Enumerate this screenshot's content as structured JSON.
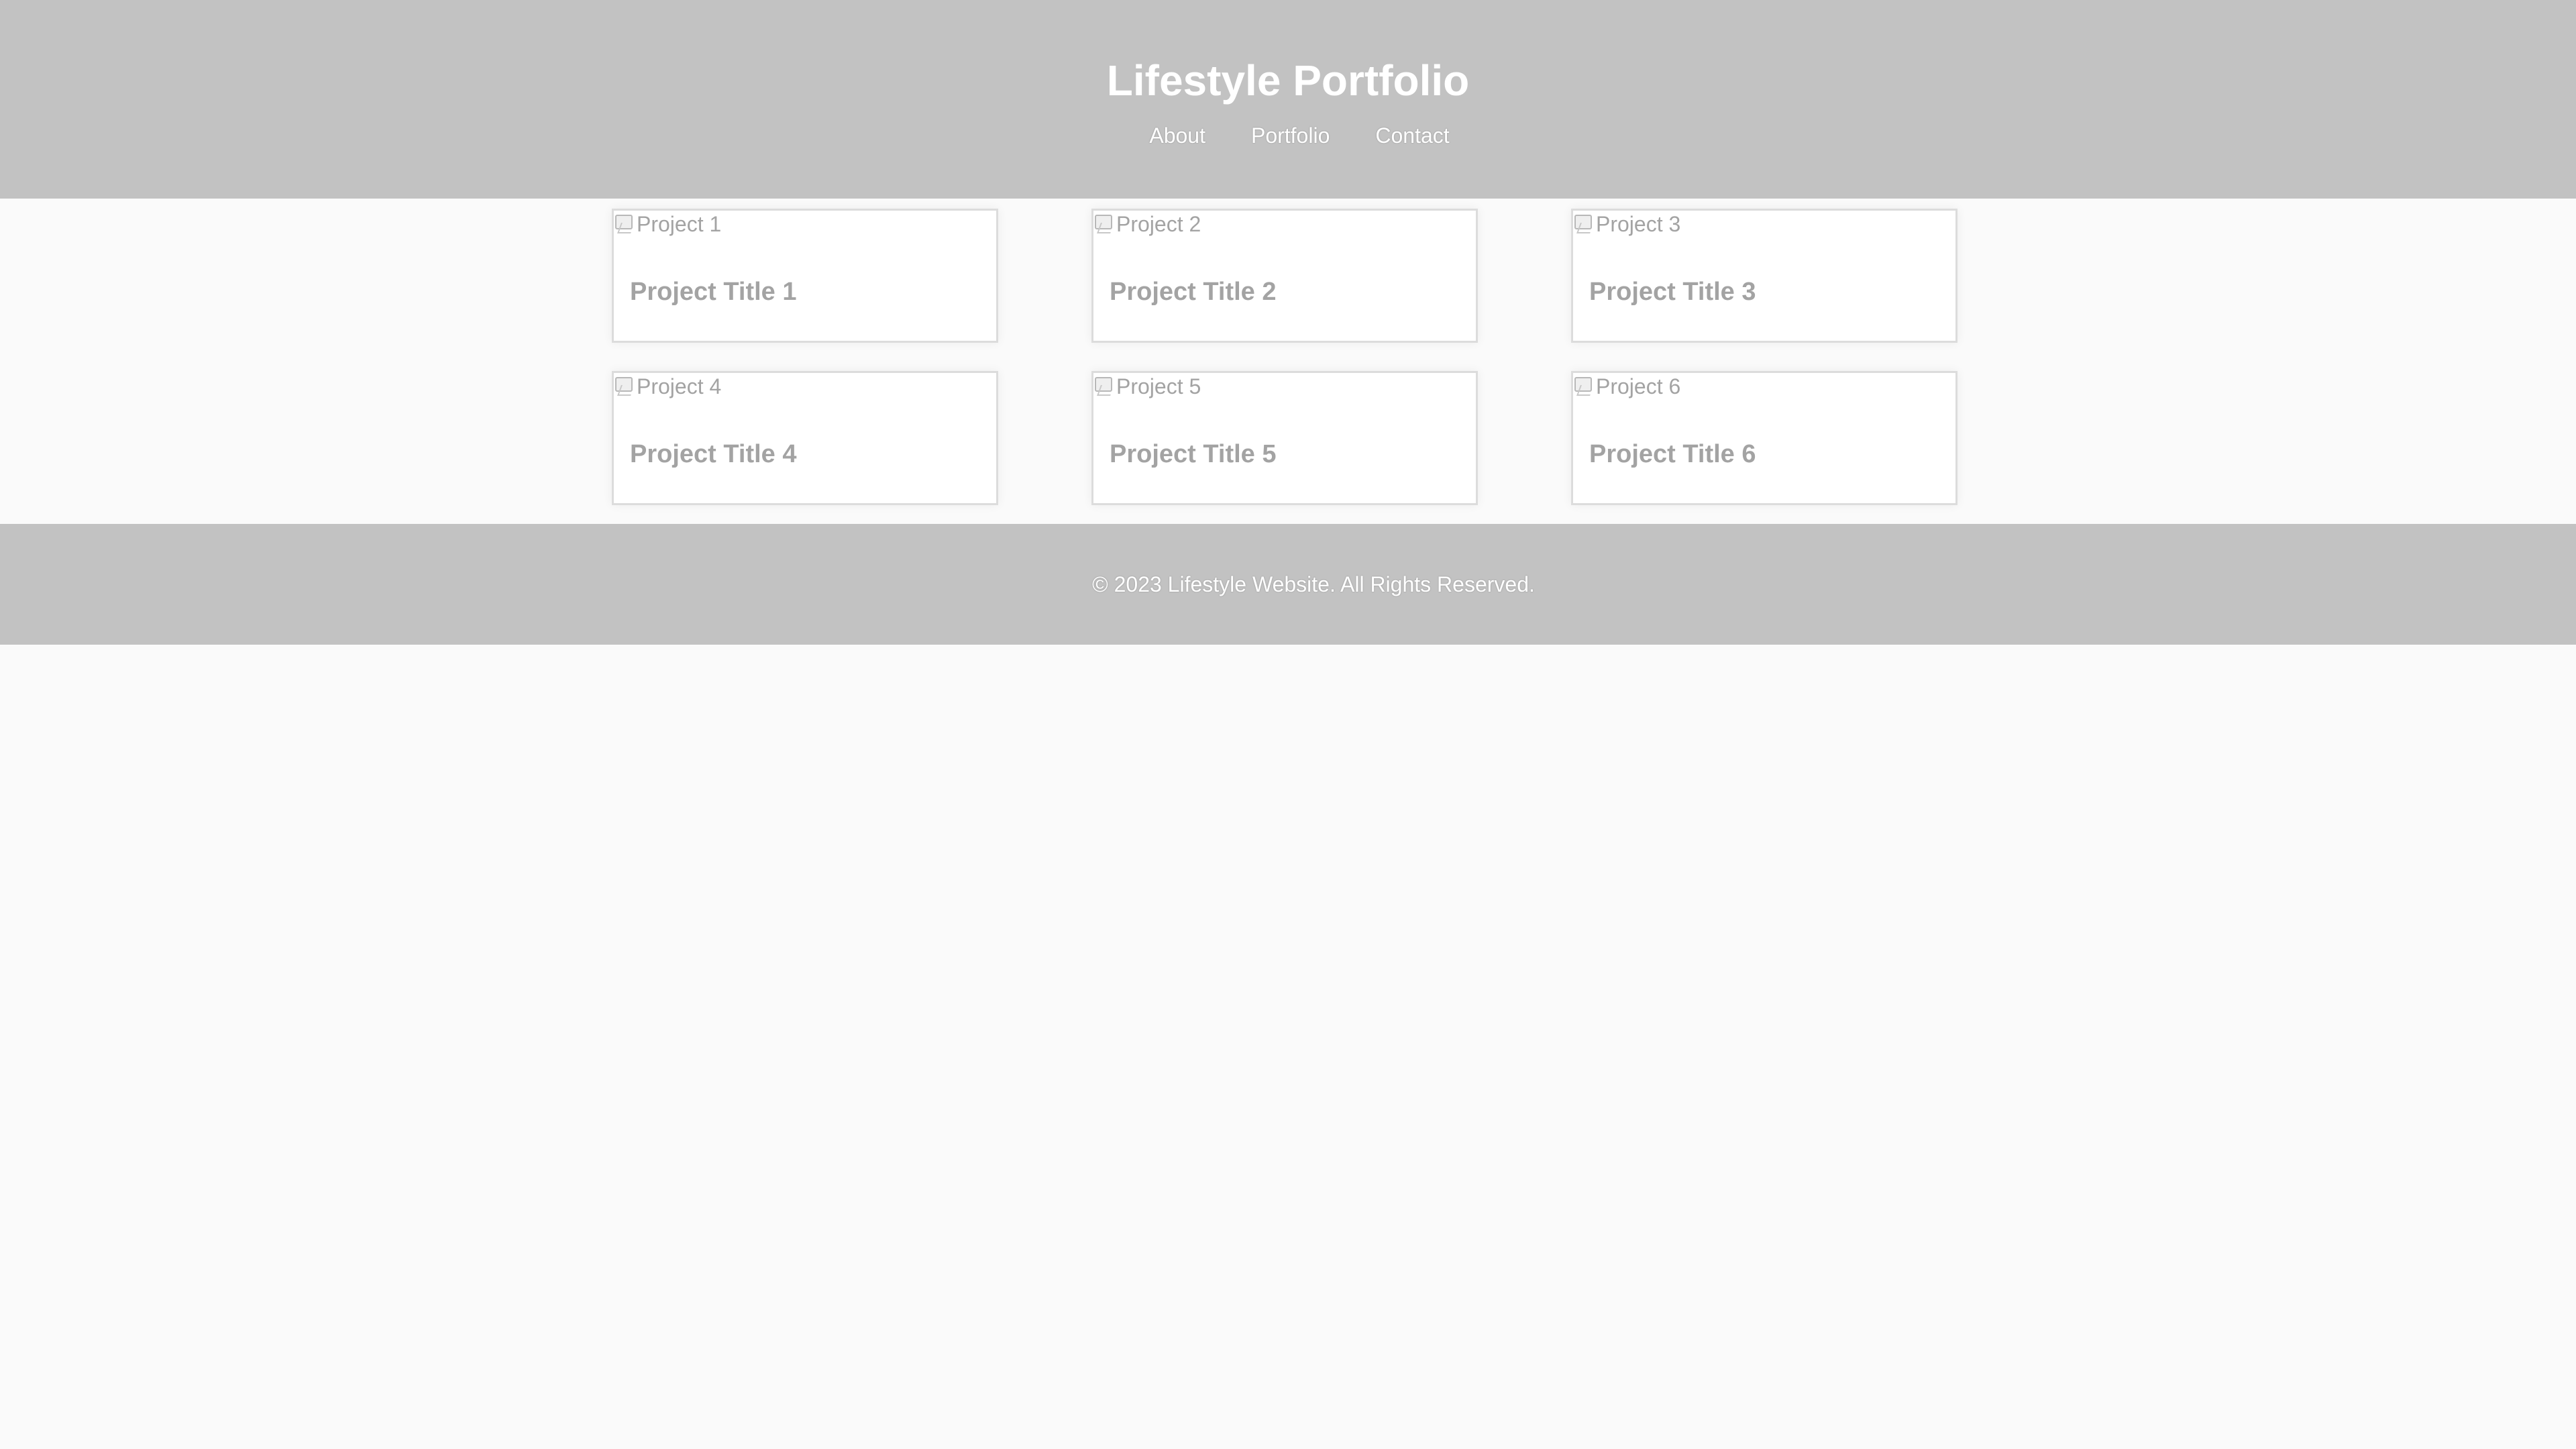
{
  "header": {
    "title": "Lifestyle Portfolio",
    "nav": [
      {
        "label": "About"
      },
      {
        "label": "Portfolio"
      },
      {
        "label": "Contact"
      }
    ]
  },
  "projects": [
    {
      "image_alt": "Project 1",
      "title": "Project Title 1"
    },
    {
      "image_alt": "Project 2",
      "title": "Project Title 2"
    },
    {
      "image_alt": "Project 3",
      "title": "Project Title 3"
    },
    {
      "image_alt": "Project 4",
      "title": "Project Title 4"
    },
    {
      "image_alt": "Project 5",
      "title": "Project Title 5"
    },
    {
      "image_alt": "Project 6",
      "title": "Project Title 6"
    }
  ],
  "footer": {
    "copyright": "© 2023 Lifestyle Website. All Rights Reserved."
  },
  "colors": {
    "header_bg": "#c2c2c2",
    "page_bg": "#fafafa",
    "muted_text": "#a3a3a3"
  }
}
